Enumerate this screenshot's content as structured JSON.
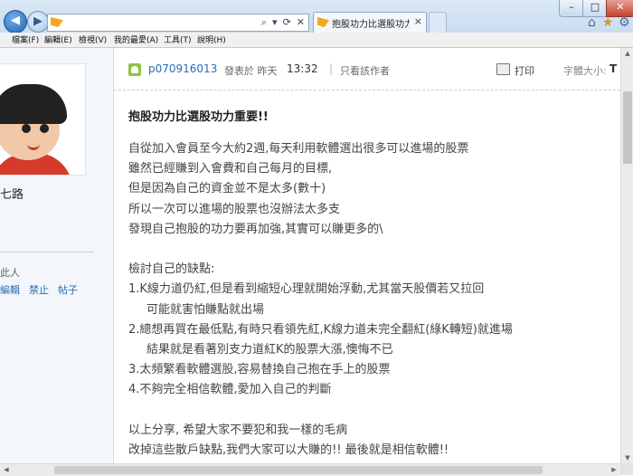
{
  "browser": {
    "tab_title": "抱股功力比選股功力重要!! ...",
    "menu": [
      "檔案(F)",
      "編輯(E)",
      "檢視(V)",
      "我的最愛(A)",
      "工具(T)",
      "說明(H)"
    ],
    "window_controls": {
      "minimize": "–",
      "maximize": "□",
      "close": "✕"
    },
    "addr_icons": {
      "search": "⌕",
      "dropdown": "▾",
      "refresh": "⟳",
      "stop": "✕"
    }
  },
  "sidebar": {
    "username_fragment": "七路",
    "label_fragment": "此人",
    "links": [
      "編輯",
      "禁止",
      "帖子"
    ]
  },
  "post_header": {
    "author": "p070916013",
    "posted_label": "發表於 昨天",
    "posted_time": "13:32",
    "separator": "|",
    "only_author": "只看該作者",
    "print": "打印",
    "font_size_label": "字體大小:",
    "font_size_value": "T"
  },
  "post": {
    "title": "抱股功力比選股功力重要!!",
    "body": [
      "自從加入會員至今大約2週,每天利用軟體選出很多可以進場的股票",
      "雖然已經賺到入會費和自己每月的目標,",
      "但是因為自己的資金並不是太多(數十)",
      "所以一次可以進場的股票也沒辦法太多支",
      "發現自己抱股的功力要再加強,其實可以賺更多的\\"
    ],
    "review_heading": "檢討自己的缺點:",
    "review": [
      "1.K線力道仍紅,但是看到縮短心理就開始浮動,尤其當天股價若又拉回",
      "可能就害怕賺點就出場",
      "2.總想再買在最低點,有時只看領先紅,K線力道未完全翻紅(綠K轉短)就進場",
      "結果就是看著別支力道紅K的股票大漲,懊悔不已",
      "3.太頻繁看軟體選股,容易替換自己抱在手上的股票",
      "4.不夠完全相信軟體,愛加入自己的判斷"
    ],
    "closing": [
      "以上分享, 希望大家不要犯和我一樣的毛病",
      "改掉這些散戶缺點,我們大家可以大賺的!!  最後就是相信軟體!!"
    ]
  },
  "colors": {
    "link": "#2a6eb5",
    "online_icon": "#8cc63f",
    "chrome": "#c9dcf0"
  }
}
